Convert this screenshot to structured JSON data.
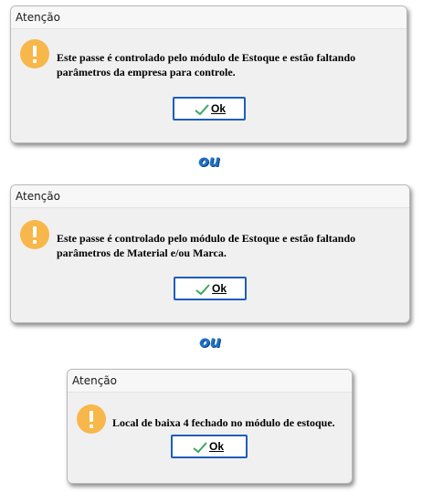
{
  "dialogs": [
    {
      "title": "Atenção",
      "message_lines": [
        "Este passe é controlado pelo módulo de Estoque e estão faltando",
        "parâmetros da empresa para controle."
      ],
      "ok_label": "Ok",
      "icon": "warning-icon",
      "check_icon": "checkmark-icon"
    },
    {
      "title": "Atenção",
      "message_lines": [
        "Este passe é controlado pelo módulo de Estoque e estão faltando",
        "parâmetros de Material e/ou Marca."
      ],
      "ok_label": "Ok",
      "icon": "warning-icon",
      "check_icon": "checkmark-icon"
    },
    {
      "title": "Atenção",
      "message_lines": [
        "Local de baixa 4 fechado no módulo de estoque."
      ],
      "ok_label": "Ok",
      "icon": "warning-icon",
      "check_icon": "checkmark-icon"
    }
  ],
  "separators": [
    "ou",
    "ou"
  ],
  "colors": {
    "warning": "#f7b74b",
    "button_border": "#1e5eb8",
    "checkmark": "#3aa85a",
    "separator": "#1f73c9"
  }
}
